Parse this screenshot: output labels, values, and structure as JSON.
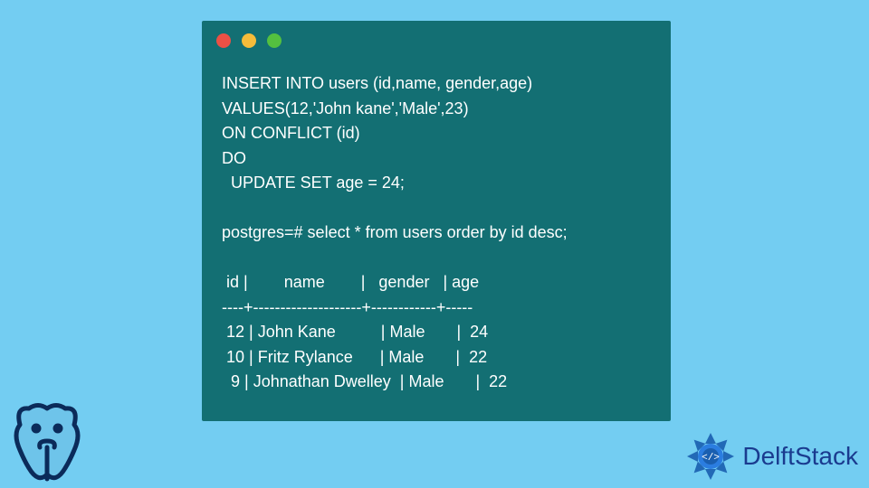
{
  "terminal": {
    "lines": [
      "INSERT INTO users (id,name, gender,age)",
      "VALUES(12,'John kane','Male',23)",
      "ON CONFLICT (id)",
      "DO",
      "  UPDATE SET age = 24;",
      "",
      "postgres=# select * from users order by id desc;",
      "",
      " id |        name        |   gender   | age",
      "----+--------------------+------------+-----",
      " 12 | John Kane          | Male       |  24",
      " 10 | Fritz Rylance      | Male       |  22",
      "  9 | Johnathan Dwelley  | Male       |  22"
    ]
  },
  "brand": {
    "name": "DelftStack"
  },
  "window_controls": {
    "red": "#ec5045",
    "yellow": "#f6bc3a",
    "green": "#54c03f"
  }
}
